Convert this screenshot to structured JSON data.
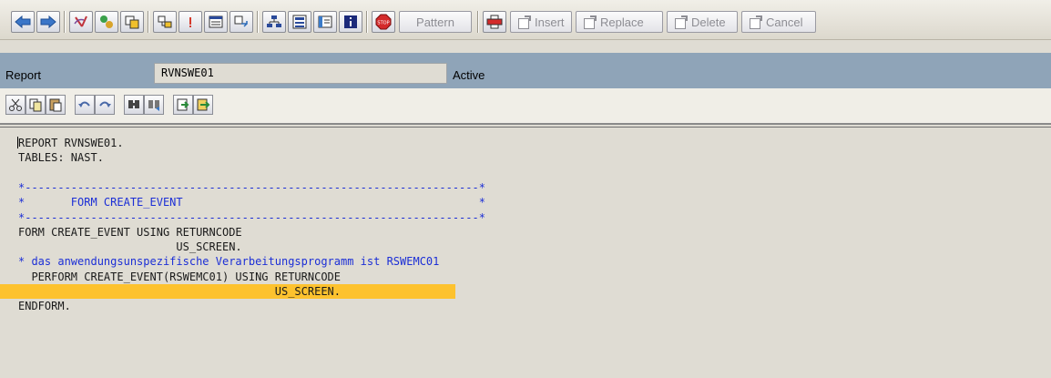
{
  "toolbar": {
    "pattern_label": "Pattern",
    "insert_label": "Insert",
    "replace_label": "Replace",
    "delete_label": "Delete",
    "cancel_label": "Cancel"
  },
  "report": {
    "label": "Report",
    "name": "RVNSWE01",
    "status": "Active"
  },
  "code": {
    "lines": [
      {
        "text": "REPORT RVNSWE01.",
        "kind": "normal"
      },
      {
        "text": "TABLES: NAST.",
        "kind": "normal"
      },
      {
        "text": "",
        "kind": "normal"
      },
      {
        "text": "*---------------------------------------------------------------------*",
        "kind": "comment"
      },
      {
        "text": "*       FORM CREATE_EVENT                                             *",
        "kind": "comment"
      },
      {
        "text": "*---------------------------------------------------------------------*",
        "kind": "comment"
      },
      {
        "text": "FORM CREATE_EVENT USING RETURNCODE",
        "kind": "normal"
      },
      {
        "text": "                        US_SCREEN.",
        "kind": "normal"
      },
      {
        "text": "* das anwendungsunspezifische Verarbeitungsprogramm ist RSWEMC01",
        "kind": "comment"
      },
      {
        "text": "  PERFORM CREATE_EVENT(RSWEMC01) USING RETURNCODE",
        "kind": "normal"
      },
      {
        "text": "                                       US_SCREEN.",
        "kind": "highlight"
      },
      {
        "text": "ENDFORM.",
        "kind": "normal"
      }
    ]
  },
  "colors": {
    "header_bar": "#8fa4b8",
    "comment": "#1c2fd6",
    "highlight": "#fdc22e"
  }
}
